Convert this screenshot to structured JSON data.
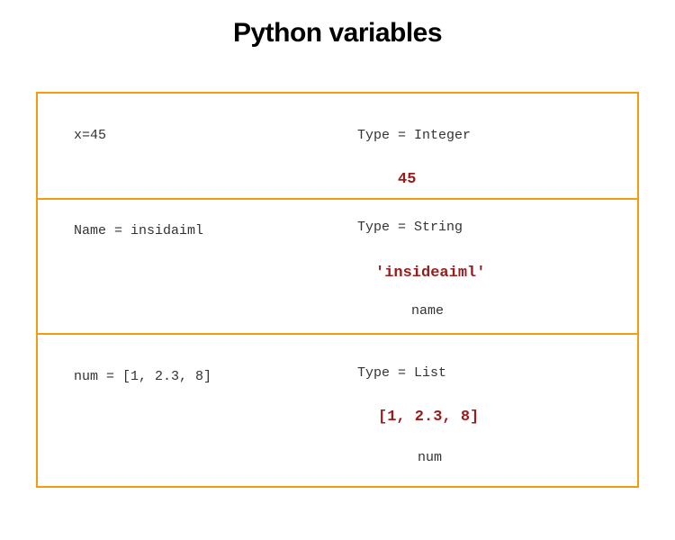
{
  "title": "Python variables",
  "rows": [
    {
      "code": "x=45",
      "type": "Type = Integer",
      "value": "45",
      "label": ""
    },
    {
      "code": "Name = insidaiml",
      "type": "Type = String",
      "value": "'insideaiml'",
      "label": "name"
    },
    {
      "code": "num = [1, 2.3, 8]",
      "type": "Type = List",
      "value": "[1, 2.3, 8]",
      "label": "num"
    }
  ]
}
